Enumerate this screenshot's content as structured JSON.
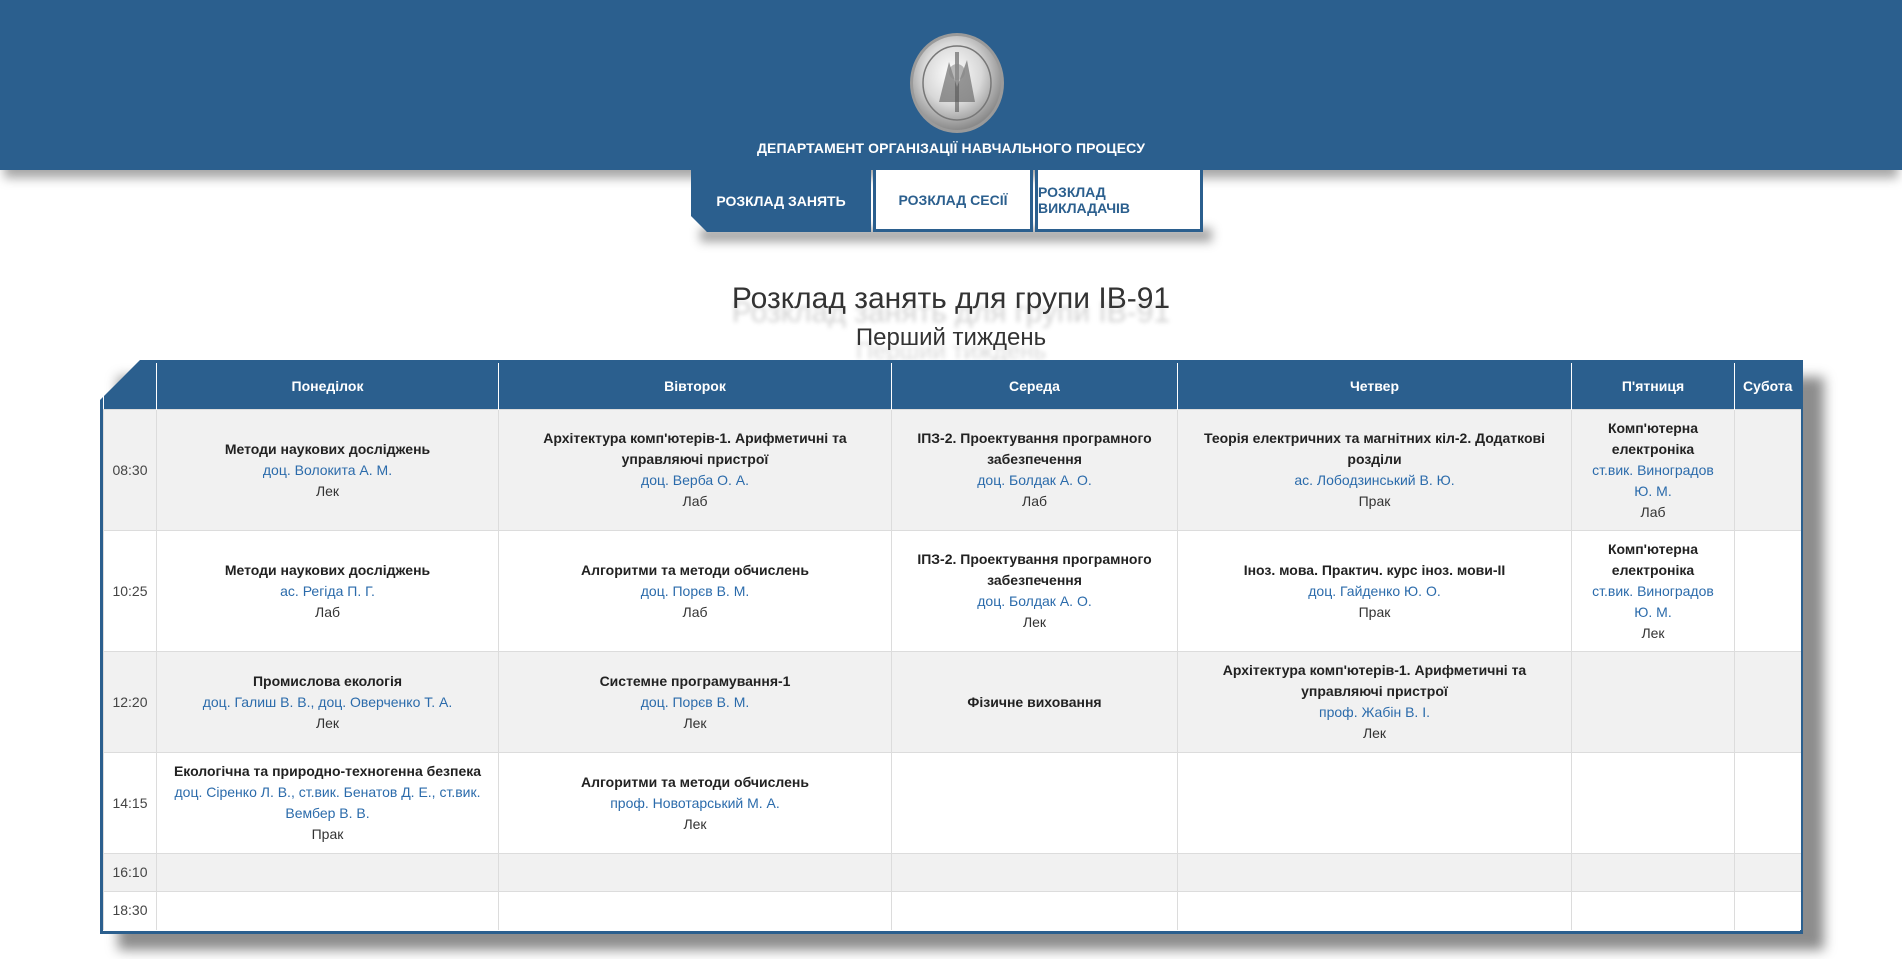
{
  "header": {
    "department": "ДЕПАРТАМЕНТ ОРГАНІЗАЦІЇ НАВЧАЛЬНОГО ПРОЦЕСУ",
    "seal_icon": "university-seal-icon"
  },
  "tabs": [
    {
      "label": "РОЗКЛАД ЗАНЯТЬ",
      "active": true
    },
    {
      "label": "РОЗКЛАД СЕСІЇ",
      "active": false
    },
    {
      "label": "РОЗКЛАД ВИКЛАДАЧІВ",
      "active": false
    }
  ],
  "title": "Розклад занять для групи ІВ-91",
  "week": "Перший тиждень",
  "colors": {
    "primary": "#2b5f8e",
    "link": "#2b6bab"
  },
  "schedule": {
    "days": [
      "Понеділок",
      "Вівторок",
      "Середа",
      "Четвер",
      "П'ятниця",
      "Субота"
    ],
    "rows": [
      {
        "time": "08:30",
        "cells": [
          {
            "subject": "Методи наукових досліджень",
            "teacher": "доц. Волокита А. М.",
            "type": "Лек"
          },
          {
            "subject": "Архітектура комп'ютерів-1. Арифметичні та управляючі пристрої",
            "teacher": "доц. Верба О. А.",
            "type": "Лаб"
          },
          {
            "subject": "ІПЗ-2. Проектування програмного забезпечення",
            "teacher": "доц. Болдак А. О.",
            "type": "Лаб"
          },
          {
            "subject": "Теорія електричних та магнітних кіл-2. Додаткові розділи",
            "teacher": "ас. Лободзинський В. Ю.",
            "type": "Прак"
          },
          {
            "subject": "Комп'ютерна електроніка",
            "teacher": "ст.вик. Виноградов Ю. М.",
            "type": "Лаб"
          },
          null
        ]
      },
      {
        "time": "10:25",
        "cells": [
          {
            "subject": "Методи наукових досліджень",
            "teacher": "ас. Регіда П. Г.",
            "type": "Лаб"
          },
          {
            "subject": "Алгоритми та методи обчислень",
            "teacher": "доц. Порєв В. М.",
            "type": "Лаб"
          },
          {
            "subject": "ІПЗ-2. Проектування програмного забезпечення",
            "teacher": "доц. Болдак А. О.",
            "type": "Лек"
          },
          {
            "subject": "Іноз. мова. Практич. курс іноз. мови-II",
            "teacher": "доц. Гайденко Ю. О.",
            "type": "Прак"
          },
          {
            "subject": "Комп'ютерна електроніка",
            "teacher": "ст.вик. Виноградов Ю. М.",
            "type": "Лек"
          },
          null
        ]
      },
      {
        "time": "12:20",
        "cells": [
          {
            "subject": "Промислова екологія",
            "teacher": "доц. Галиш В. В., доц. Оверченко Т. А.",
            "type": "Лек"
          },
          {
            "subject": "Системне програмування-1",
            "teacher": "доц. Порєв В. М.",
            "type": "Лек"
          },
          {
            "subject": "Фізичне виховання",
            "teacher": "",
            "type": ""
          },
          {
            "subject": "Архітектура комп'ютерів-1. Арифметичні та управляючі пристрої",
            "teacher": "проф. Жабін В. І.",
            "type": "Лек"
          },
          null,
          null
        ]
      },
      {
        "time": "14:15",
        "cells": [
          {
            "subject": "Екологічна та природно-техногенна безпека",
            "teacher": "доц. Сіренко Л. В., ст.вик. Бенатов Д. Е., ст.вик. Вембер В. В.",
            "type": "Прак"
          },
          {
            "subject": "Алгоритми та методи обчислень",
            "teacher": "проф. Новотарський М. А.",
            "type": "Лек"
          },
          null,
          null,
          null,
          null
        ]
      },
      {
        "time": "16:10",
        "cells": [
          null,
          null,
          null,
          null,
          null,
          null
        ]
      },
      {
        "time": "18:30",
        "cells": [
          null,
          null,
          null,
          null,
          null,
          null
        ]
      }
    ]
  }
}
